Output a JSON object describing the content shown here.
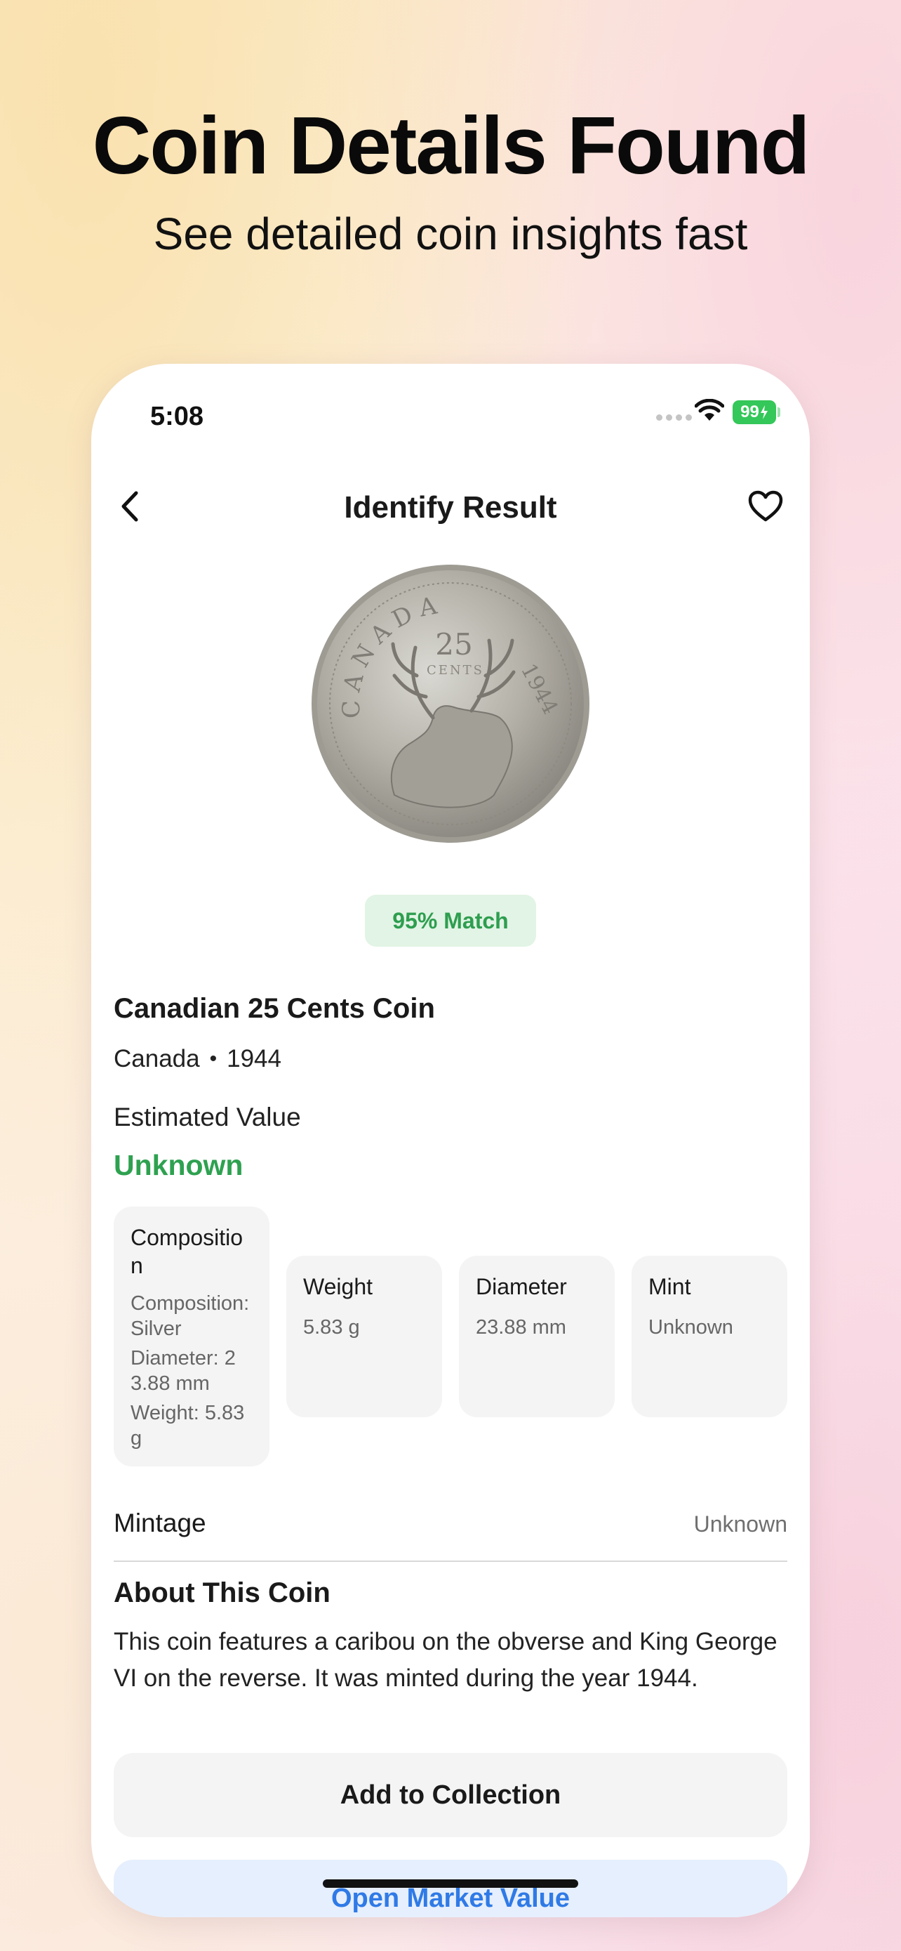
{
  "promo": {
    "headline": "Coin Details Found",
    "subheadline": "See detailed coin insights fast"
  },
  "status_bar": {
    "time": "5:08",
    "battery": "99"
  },
  "nav": {
    "title": "Identify Result",
    "back_icon": "chevron-left-icon",
    "favorite_icon": "heart-icon"
  },
  "coin": {
    "image_icon": "coin-photo",
    "engraving": {
      "country": "CANADA",
      "value": "25",
      "unit": "CENTS",
      "year": "1944"
    },
    "match": "95% Match",
    "name": "Canadian 25 Cents Coin",
    "country": "Canada",
    "separator": "•",
    "year": "1944",
    "estimated_value_label": "Estimated Value",
    "estimated_value": "Unknown"
  },
  "specs": [
    {
      "label": "Composition",
      "details": [
        "Composition: Silver",
        "Diameter: 23.88 mm",
        "Weight: 5.83 g"
      ]
    },
    {
      "label": "Weight",
      "value": "5.83 g"
    },
    {
      "label": "Diameter",
      "value": "23.88 mm"
    },
    {
      "label": "Mint",
      "value": "Unknown"
    }
  ],
  "mintage": {
    "label": "Mintage",
    "value": "Unknown"
  },
  "about": {
    "title": "About This Coin",
    "text": "This coin features a caribou on the obverse and King George VI on the reverse. It was minted during the year 1944."
  },
  "actions": {
    "add_to_collection": "Add to Collection",
    "open_market_value": "Open Market Value"
  },
  "colors": {
    "accent_green": "#2ea150",
    "match_bg": "#e2f4e5",
    "market_blue": "#2f7ae6",
    "market_bg": "#e6effd",
    "battery_green": "#34c759"
  }
}
